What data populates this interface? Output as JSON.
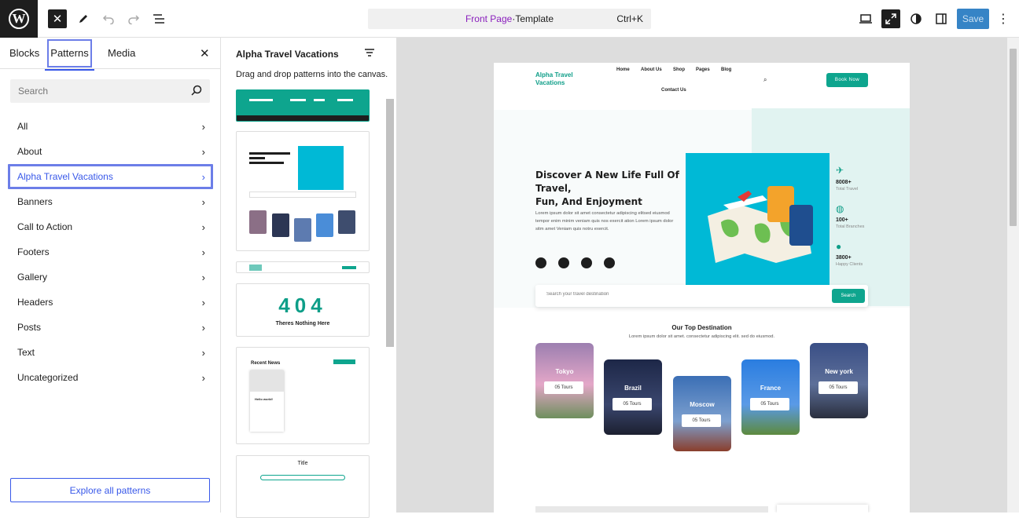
{
  "topbar": {
    "close_icon": "✕",
    "command": {
      "page": "Front Page",
      "separator": " · ",
      "template": "Template",
      "shortcut": "Ctrl+K"
    },
    "save_label": "Save"
  },
  "sidebar": {
    "tabs": {
      "blocks": "Blocks",
      "patterns": "Patterns",
      "media": "Media"
    },
    "search_placeholder": "Search",
    "categories": [
      {
        "label": "All"
      },
      {
        "label": "About"
      },
      {
        "label": "Alpha Travel Vacations"
      },
      {
        "label": "Banners"
      },
      {
        "label": "Call to Action"
      },
      {
        "label": "Footers"
      },
      {
        "label": "Gallery"
      },
      {
        "label": "Headers"
      },
      {
        "label": "Posts"
      },
      {
        "label": "Text"
      },
      {
        "label": "Uncategorized"
      }
    ],
    "explore_label": "Explore all patterns"
  },
  "patterns_panel": {
    "title": "Alpha Travel Vacations",
    "description": "Drag and drop patterns into the canvas.",
    "card404": {
      "code": "404",
      "text": "Theres Nothing Here"
    },
    "card_news": {
      "title": "Recent News",
      "post": "Hello world!"
    },
    "card_title": {
      "title": "Title"
    }
  },
  "site": {
    "logo": "Alpha Travel\nVacations",
    "nav": [
      "Home",
      "About Us",
      "Shop",
      "Pages",
      "Blog",
      "Contact Us"
    ],
    "book_now": "Book Now",
    "hero": {
      "heading_1": "Discover A New Life Full Of",
      "heading_2": "Travel,",
      "heading_3": "Fun, And Enjoyment",
      "body": "Lorem ipsum dolor sit amet consectetur adipiscing elitsed eiusmod tempor enim minim veniam quis nos exercit ation Lorem ipsum dolor sitm amet Veniam quis notru exercit."
    },
    "stats": [
      {
        "num": "8008+",
        "label": "Total Travel"
      },
      {
        "num": "100+",
        "label": "Total Branches"
      },
      {
        "num": "3800+",
        "label": "Happy Clients"
      }
    ],
    "search_placeholder": "Search your travel destination",
    "search_btn": "Search",
    "dest_title": "Our Top Destination",
    "dest_sub": "Lorem ipsum dolor sit amet. consectetur adipiscing elit. sed do eiusmod.",
    "destinations": [
      {
        "name": "Tokyo",
        "tours": "05 Tours"
      },
      {
        "name": "Brazil",
        "tours": "05 Tours"
      },
      {
        "name": "Moscow",
        "tours": "05 Tours"
      },
      {
        "name": "France",
        "tours": "05 Tours"
      },
      {
        "name": "New york",
        "tours": "05 Tours"
      }
    ]
  }
}
